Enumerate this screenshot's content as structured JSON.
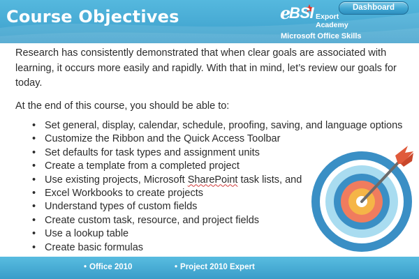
{
  "header": {
    "title": "Course Objectives",
    "dashboard_label": "Dashboard",
    "logo": {
      "e_letter": "e",
      "bsi": "BSI",
      "line1": "Export",
      "line2": "Academy",
      "tagline": "Microsoft Office Skills"
    }
  },
  "content": {
    "intro": "Research has consistently demonstrated that when clear goals are associated with learning, it occurs more easily and rapidly. With that in mind, let’s review our goals for today.",
    "lead_in": "At the end of this course, you should be able to:",
    "objectives": [
      "Set general, display, calendar, schedule, proofing, saving, and language options",
      "Customize the Ribbon and the Quick Access Toolbar",
      "Set defaults for task types and assignment units",
      "Create a template from a completed project",
      "Excel Workbooks to create projects",
      "Understand types of custom fields",
      "Create custom task, resource, and project fields",
      "Use a lookup table",
      "Create basic formulas"
    ],
    "sharepoint_item": {
      "before": "Use existing projects, Microsoft ",
      "highlight": "SharePoint",
      "after": " task lists, and"
    }
  },
  "footer": {
    "items": [
      "Office 2010",
      "Project 2010 Expert"
    ]
  },
  "icons": {
    "target": "target-icon",
    "bullet": "bullet-dot"
  },
  "colors": {
    "header_blue": "#3c9fcb",
    "target_outer": "#3a8fc5",
    "target_middle": "#a9dcf0",
    "target_ring": "#f07c5e",
    "target_center": "#f5b547",
    "arrow": "#6b6b6b",
    "fletching": "#e05a3b"
  }
}
